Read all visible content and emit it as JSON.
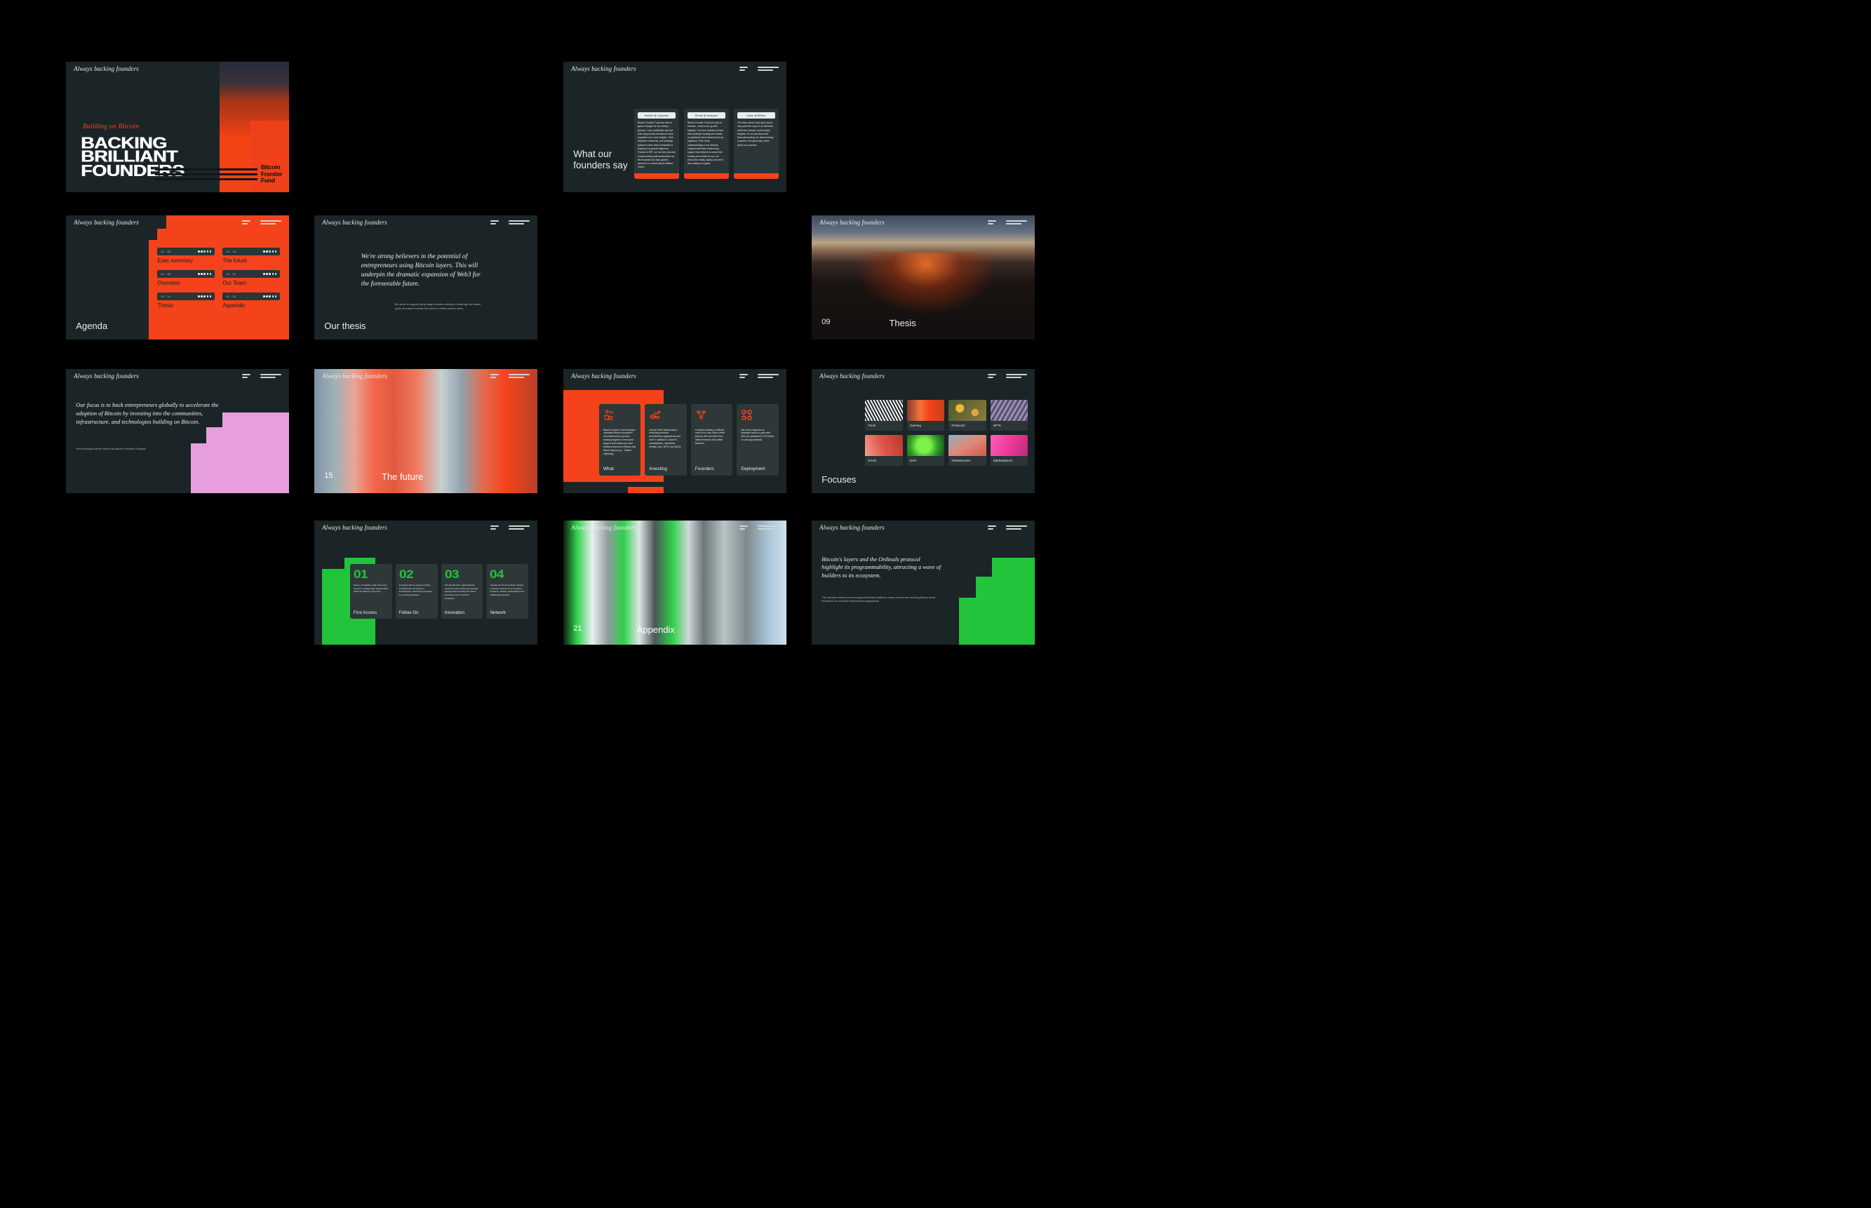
{
  "brand": {
    "tagline": "Always backing founders",
    "fund_name_lines": [
      "Bitcoin",
      "Frontier",
      "Fund"
    ],
    "accent_orange": "#f4421a",
    "accent_green": "#21c43a",
    "accent_pink": "#e79ede",
    "slide_bg": "#1b2426",
    "card_bg": "#2e3839",
    "page_bg": "#000000"
  },
  "slides": {
    "title": {
      "eyebrow": "Building on Bitcoin",
      "headline_lines": [
        "BACKING",
        "BRILLIANT",
        "FOUNDERS"
      ]
    },
    "founders_say": {
      "title_lines": [
        "What our",
        "founders say"
      ],
      "testimonials": [
        {
          "name": "Robbie @ Liquidium",
          "quote": "Bitcoin Frontier Fund has been a game-changer for our startup journey. I can confidently say that their support and investment have propelled us to new heights. Their expertise, networks, and strategic guidance have been invaluable in shaping our growth trajectory. Thanks to BFF, we not only secured crucial funding that accelerated our development but also gained access to a community of brilliant minds."
        },
        {
          "name": "Ronak @ Wrapped",
          "quote": "Bitcoin Frontier Fund isn't just an investor – they're our growth catalyst. I've been amazed at how their strategic funding and hands-on guidance have transformed our trajectory. Their deep understanding of our industry coupled with their unwavering support has helped us secure the funding we needed to turn our vision into reality capital, but we're also raising our game."
        },
        {
          "name": "Dylan @ Bitflow",
          "quote": "The team doesn't just open doors; they pave the way for us with their extensive network and industry insights. It's not just about the financial backing; it's about having a partner who genuinely cares about our success."
        }
      ]
    },
    "agenda": {
      "title": "Agenda",
      "items": [
        {
          "range": "01 - 03",
          "label": "Exec summary",
          "dots_filled": 2
        },
        {
          "range": "15 - 18",
          "label": "The future",
          "dots_filled": 2
        },
        {
          "range": "04 - 08",
          "label": "Overview",
          "dots_filled": 3
        },
        {
          "range": "19 - 20",
          "label": "Our Team",
          "dots_filled": 3
        },
        {
          "range": "09 - 14",
          "label": "Thesis",
          "dots_filled": 3
        },
        {
          "range": "21 - 26",
          "label": "Appendix",
          "dots_filled": 3
        }
      ]
    },
    "our_thesis": {
      "title": "Our thesis",
      "lead": "We're strong believers in the potential of entrepreneurs using Bitcoin layers. This will underpin the dramatic expansion of Web3 for the foreseeable future.",
      "sub": "We strive to support early stage founders willing to challenge the status quote and push forward the road to a billion bitcoin users."
    },
    "thesis_section": {
      "number": "09",
      "name": "Thesis"
    },
    "our_focus": {
      "lead": "Our focus is to back entrepreneurs globally to accelerate the adoption of Bitcoin by investing into the communities, infrastructure, and technologies building on Bitcoin.",
      "sub": "We've already built the world's top Bitcoin Founders Program"
    },
    "future_section": {
      "number": "15",
      "name": "The future"
    },
    "what_investing": {
      "cards": [
        {
          "icon": "factory-icon",
          "label": "What",
          "text": "Bitcoin Frontier Fund leverages unrivalled Bitcoin ecosystem connections and a proven scaling program to invest and support world-class pre-seed dealflow focused on Bitcoin and Bitcoin layers (e.g. - Stacks, Lightning)."
        },
        {
          "icon": "growth-coins-icon",
          "label": "Investing",
          "text": "Across Web3 infrastructure, including protocols, decentralized applications and DeFi in addition to GameFi, marketplaces, metaverse, identity, civic, NFTs, and DAOs."
        },
        {
          "icon": "network-people-icon",
          "label": "Founders",
          "text": "Founders building on Bitcoin come to us very early in their journey. We turn them from native inventors into bolder founders."
        },
        {
          "icon": "grid-deploy-icon",
          "label": "Deployment",
          "text": "We hold companies as deployed cash in a year with 50% pre-positioned 1-2% follow-on and opportunistic."
        }
      ]
    },
    "focuses": {
      "title": "Focuses",
      "cells": [
        {
          "label": "Tools",
          "swatch": "#cfd4d6"
        },
        {
          "label": "Gaming",
          "swatch": "#e8643a"
        },
        {
          "label": "Protocols",
          "swatch": "#c99a3e"
        },
        {
          "label": "NFTs",
          "swatch": "#8b7fa8"
        },
        {
          "label": "DAOs",
          "swatch": "#e0665a"
        },
        {
          "label": "DeFi",
          "swatch": "#4cc83a"
        },
        {
          "label": "Infrastructure",
          "swatch": "#d97a6a"
        },
        {
          "label": "Marketplaces",
          "swatch": "#f05fb4"
        }
      ]
    },
    "benefits": {
      "cards": [
        {
          "number": "01",
          "label": "First Access",
          "text": "Gain a competitive edge with early access to cutting-edge opportunities within the Bitcoin ecosystem."
        },
        {
          "number": "02",
          "label": "Follow On",
          "text": "Investing with us ensures priority consideration for follow-on investments, maximizing exposure to promising startups."
        },
        {
          "number": "03",
          "label": "Innovation",
          "text": "LPs benefit from organizational resources and continuous learning, staying informed about the latest developments in the BTC landscape."
        },
        {
          "number": "04",
          "label": "Network",
          "text": "Joining our LP-led network unlocks a diverse network of co-investors, founders, industry partnerships and collaborative growth."
        }
      ]
    },
    "appendix_section": {
      "number": "21",
      "name": "Appendix"
    },
    "ordinals": {
      "lead": "Bitcoin's layers and the Ordinals protocol highlight its programmability, attracting a wave of builders to its ecosystem.",
      "sub": "This includes creators from emerging blockchain platforms, many of whom are investing Bitcoin as the foundation for innovative decentralized applications."
    }
  }
}
